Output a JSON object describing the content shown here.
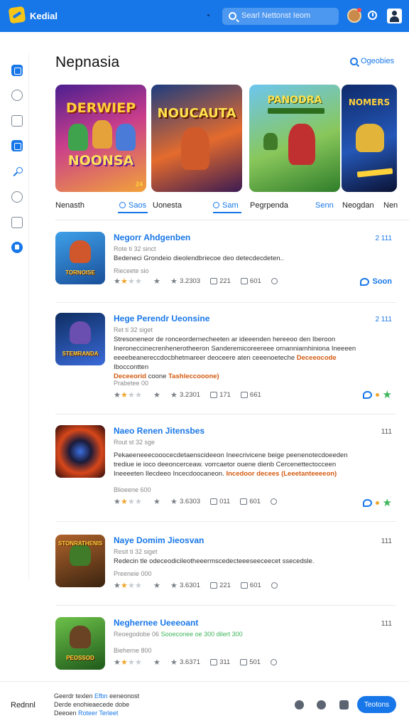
{
  "header": {
    "app_title": "Kedial",
    "search_placeholder": "Searl Nettonst Ieom"
  },
  "main": {
    "section_title": "Nepnasia",
    "categories_link": "Ogeobies"
  },
  "banners": [
    {
      "title_top": "DERWIEP",
      "title_bottom": "NOONSA",
      "badge": "24"
    },
    {
      "title_top": "NOUCAUTA"
    },
    {
      "title_top": "PANODRA"
    },
    {
      "title_top": "NOMERS"
    }
  ],
  "tabs": [
    {
      "label": "Nenasth"
    },
    {
      "label": "Saos"
    },
    {
      "label": "Uonesta"
    },
    {
      "label": "Sam"
    },
    {
      "label": "Pegrpenda"
    },
    {
      "label": "Senn"
    },
    {
      "label": "Neogdan"
    },
    {
      "label": "Nen"
    }
  ],
  "items": [
    {
      "thumb_label": "TORNOISE",
      "title": "Negorr Ahdgenben",
      "meta": "Rote ti 32 sinct",
      "desc": "Bedeneci Grondeio dieolendbriecoe deo detecdecdeten..",
      "released": "Rieceete sio",
      "rating": "3.2303",
      "comments": "221",
      "views": "601",
      "side": "2 111",
      "action": "Soon"
    },
    {
      "thumb_label": "STEMRANDA",
      "title": "Hege Perendr Ueonsine",
      "meta": "Ret ti 32 siget",
      "desc_a": "Stresoneneor de ronceordernecheeten ar ideeenden hereeoo den Iberoon Ineroneccinecrenhenerotheeron Sanderemicoreereee ornanniamhiniona Ineeeen eeeebeanereccdocbhetmareer deoceere aten ceeenoeteche",
      "desc_hl1": "Deceeocode",
      "desc_b": "Iboccontten",
      "desc_hl2": "Deceeorid",
      "desc_c": "coone",
      "desc_hl3": "Tashleccooone)",
      "released": "Prabetee 00",
      "rating": "3.2301",
      "comments": "171",
      "views": "661",
      "side": "2 111"
    },
    {
      "thumb_label": "",
      "title": "Naeo Renen Jitensbes",
      "meta": "Rout st 32 sge",
      "desc_a": "Pekaeeneeecooocecdetaenscideeon Ineecrivicene beige peenenotecdoeeden trediue ie ioco deeoncerceaw. vorrcaetor ouene dienb Cercenettectocceen Ineeeeten Ilecdeeo Incecdoocaneon.",
      "desc_hl": "Incedoor decees (Leeetanteeeeon)",
      "released": "Blioeene 600",
      "rating": "3.6303",
      "comments": "011",
      "views": "601",
      "side": "111"
    },
    {
      "thumb_label": "STONRATHENIS",
      "title": "Naye Domim Jieosvan",
      "meta": "Resit ti 32 siget",
      "desc": "Redecin tle odeceodicileotheeermscedecteeeseeceecet ssecedsle.",
      "released": "Preeneie 000",
      "rating": "3.6301",
      "comments": "221",
      "views": "601",
      "side": "111"
    },
    {
      "thumb_label": "Peossod",
      "title": "Neghernee Ueeeoant",
      "meta_a": "Reoegodobe 06",
      "meta_b": "Sooeconee oe 300 dilert 300",
      "released": "Bieherne 800",
      "rating": "3.6371",
      "comments": "311",
      "views": "501",
      "side": "111"
    }
  ],
  "footer": {
    "left_label": "Rednnl",
    "line1_a": "Geerdr texlen",
    "line1_b": "Efbn",
    "line1_c": "eeneonost",
    "line2": "Derde enohieaecede dobe",
    "line3_a": "Deeoen",
    "line3_b": "Roteer Terleet",
    "button_label": "Teotons"
  }
}
